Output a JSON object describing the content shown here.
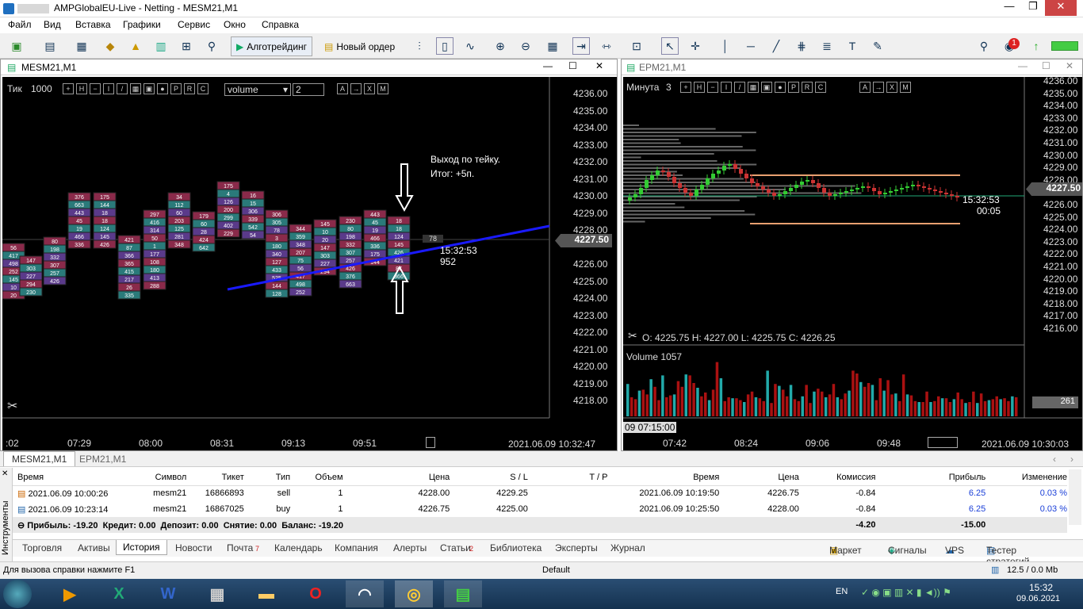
{
  "window_title": "AMPGlobalEU-Live - Netting - MESM21,M1",
  "menu": [
    "Файл",
    "Вид",
    "Вставка",
    "Графики",
    "Сервис",
    "Окно",
    "Справка"
  ],
  "toolbar": {
    "algo_label": "Алготрейдинг",
    "new_order_label": "Новый ордер",
    "notif_count": "1"
  },
  "left_chart": {
    "title": "MESM21,M1",
    "tick_label": "Тик",
    "tick_val": "1000",
    "volume_select": "volume",
    "num_val": "2",
    "price_labels": [
      "4236.00",
      "4235.00",
      "4234.00",
      "4233.00",
      "4232.00",
      "4231.00",
      "4230.00",
      "4229.00",
      "4228.00",
      "4227.50",
      "4226.00",
      "4225.00",
      "4224.00",
      "4223.00",
      "4222.00",
      "4221.00",
      "4220.00",
      "4219.00",
      "4218.00"
    ],
    "current_price": "4227.50",
    "annotation_line1": "Выход по тейку.",
    "annotation_line2": "Итог: +5п.",
    "time_label": "15:32:53",
    "count_label": "952",
    "time_axis": [
      ":02",
      "07:29",
      "08:00",
      "08:31",
      "09:13",
      "09:51"
    ],
    "datetime": "2021.06.09 10:32:47",
    "cluster_numbers": [
      "56",
      "417",
      "498",
      "252",
      "145",
      "10",
      "20",
      "147",
      "303",
      "227",
      "294",
      "230",
      "80",
      "198",
      "332",
      "307",
      "257",
      "426",
      "376",
      "663",
      "443",
      "45",
      "19",
      "466",
      "336",
      "175",
      "144",
      "18",
      "18",
      "124",
      "145",
      "426",
      "421",
      "87",
      "366",
      "365",
      "415",
      "217",
      "26",
      "335",
      "297",
      "416",
      "314",
      "50",
      "1",
      "177",
      "108",
      "180",
      "413",
      "288",
      "34",
      "112",
      "60",
      "203",
      "125",
      "281",
      "348",
      "179",
      "60",
      "28",
      "424",
      "642",
      "175",
      "4",
      "126",
      "200",
      "299",
      "402",
      "229",
      "16",
      "15",
      "306",
      "339",
      "542",
      "54",
      "306",
      "305",
      "78",
      "3",
      "180",
      "340",
      "127",
      "433",
      "525",
      "144",
      "128",
      "344",
      "359",
      "348",
      "207",
      "75"
    ],
    "footer_num": "78"
  },
  "right_chart": {
    "title": "EPM21,M1",
    "tf_label": "Минута",
    "tf_val": "3",
    "price_labels": [
      "4236.00",
      "4235.00",
      "4234.00",
      "4233.00",
      "4232.00",
      "4231.00",
      "4230.00",
      "4229.00",
      "4228.00",
      "4227.50",
      "4226.00",
      "4225.00",
      "4224.00",
      "4223.00",
      "4222.00",
      "4221.00",
      "4220.00",
      "4219.00",
      "4218.00",
      "4217.00",
      "4216.00"
    ],
    "current_price": "4227.50",
    "time_label": "15:32:53",
    "countdown": "00:05",
    "ohlc": "O: 4225.75   H: 4227.00   L: 4225.75   C: 4226.25",
    "volume_label": "Volume 1057",
    "volume_value": "261",
    "time_axis": [
      "09 07:15:00",
      "07:42",
      "08:24",
      "09:06",
      "09:48"
    ],
    "datetime": "2021.06.09 10:30:03",
    "volumes": [
      34,
      20,
      18,
      27,
      28,
      23,
      39,
      31,
      17,
      43,
      20,
      22,
      23,
      37,
      31,
      44,
      43,
      35,
      30,
      21,
      25,
      17,
      28,
      57,
      40,
      16,
      20,
      19,
      19,
      17,
      15,
      23,
      26,
      20,
      19,
      16,
      48,
      14,
      34,
      32,
      28,
      21,
      33,
      18,
      16,
      21,
      33,
      14,
      26,
      29,
      26,
      20,
      23,
      34,
      20,
      18,
      24,
      27,
      48,
      45,
      36,
      31,
      35,
      33,
      17,
      40,
      27,
      38,
      23,
      24,
      16,
      44,
      23,
      22,
      16,
      15,
      15,
      26,
      15,
      16,
      21,
      19,
      19,
      15,
      18,
      25,
      18,
      14,
      15,
      26,
      14,
      24,
      16,
      17,
      18,
      21,
      18,
      19,
      16,
      21,
      20
    ]
  },
  "tabs": [
    "MESM21,M1",
    "EPM21,M1"
  ],
  "table": {
    "headers": [
      "Время",
      "Символ",
      "Тикет",
      "Тип",
      "Объем",
      "Цена",
      "S / L",
      "T / P",
      "Время",
      "Цена",
      "Комиссия",
      "Прибыль",
      "Изменение"
    ],
    "rows": [
      [
        "2021.06.09 10:00:26",
        "mesm21",
        "16866893",
        "sell",
        "1",
        "4228.00",
        "4229.25",
        "",
        "2021.06.09 10:19:50",
        "4226.75",
        "-0.84",
        "6.25",
        "0.03 %"
      ],
      [
        "2021.06.09 10:23:14",
        "mesm21",
        "16867025",
        "buy",
        "1",
        "4226.75",
        "4225.00",
        "",
        "2021.06.09 10:25:50",
        "4228.00",
        "-0.84",
        "6.25",
        "0.03 %"
      ]
    ],
    "summary": "Прибыль: -19.20  Кредит: 0.00  Депозит: 0.00  Снятие: 0.00  Баланс: -19.20",
    "summary_commission": "-4.20",
    "summary_profit": "-15.00",
    "side_label": "Инструменты"
  },
  "bottom_tabs": [
    "Торговля",
    "Активы",
    "История",
    "Новости",
    "Почта",
    "Календарь",
    "Компания",
    "Алерты",
    "Статьи",
    "Библиотека",
    "Эксперты",
    "Журнал"
  ],
  "mail_badge": "7",
  "articles_badge": "2",
  "right_links": [
    "Маркет",
    "Сигналы",
    "VPS",
    "Тестер стратегий"
  ],
  "status": {
    "help": "Для вызова справки нажмите F1",
    "profile": "Default",
    "traffic": "12.5 / 0.0 Mb"
  },
  "taskbar": {
    "lang": "EN",
    "time": "15:32",
    "date": "09.06.2021"
  }
}
